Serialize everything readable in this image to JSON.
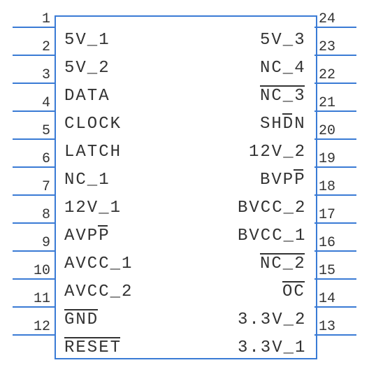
{
  "chip": {
    "left_pins": [
      {
        "num": "1",
        "name": "5V_1",
        "bar": false
      },
      {
        "num": "2",
        "name": "5V_2",
        "bar": false
      },
      {
        "num": "3",
        "name": "DATA",
        "bar": false
      },
      {
        "num": "4",
        "name": "CLOCK",
        "bar": false
      },
      {
        "num": "5",
        "name": "LATCH",
        "bar": false
      },
      {
        "num": "6",
        "name": "NC_1",
        "bar": false
      },
      {
        "num": "7",
        "name": "12V_1",
        "bar": false
      },
      {
        "num": "8",
        "name": "AVPP",
        "bar": true,
        "bar_char": 3
      },
      {
        "num": "9",
        "name": "AVCC_1",
        "bar": false
      },
      {
        "num": "10",
        "name": "AVCC_2",
        "bar": false
      },
      {
        "num": "11",
        "name": "GND",
        "bar": true,
        "bar_full": true
      },
      {
        "num": "12",
        "name": "RESET",
        "bar": true,
        "bar_full": true
      }
    ],
    "right_pins": [
      {
        "num": "24",
        "name": "5V_3",
        "bar": false
      },
      {
        "num": "23",
        "name": "NC_4",
        "bar": false
      },
      {
        "num": "22",
        "name": "NC_3",
        "bar": true,
        "bar_full": true
      },
      {
        "num": "21",
        "name": "SHDN",
        "bar": true,
        "bar_char": 2
      },
      {
        "num": "20",
        "name": "12V_2",
        "bar": false
      },
      {
        "num": "19",
        "name": "BVPP",
        "bar": true,
        "bar_char": 3
      },
      {
        "num": "18",
        "name": "BVCC_2",
        "bar": false
      },
      {
        "num": "17",
        "name": "BVCC_1",
        "bar": false
      },
      {
        "num": "16",
        "name": "NC_2",
        "bar": true,
        "bar_full": true
      },
      {
        "num": "15",
        "name": "OC",
        "bar": true,
        "bar_full": true
      },
      {
        "num": "14",
        "name": "3.3V_2",
        "bar": false
      },
      {
        "num": "13",
        "name": "3.3V_1",
        "bar": false
      }
    ]
  }
}
